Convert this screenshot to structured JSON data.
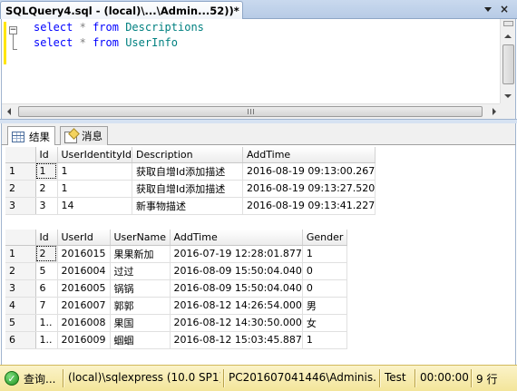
{
  "document_tab": {
    "title": "SQLQuery4.sql - (local)\\...\\Admin...52))*"
  },
  "window_buttons": {
    "pin_icon": "dropdown-arrow-icon",
    "close_label": "×"
  },
  "editor": {
    "fold_symbol": "⊟",
    "lines": [
      {
        "kw1": "select",
        "op": "*",
        "kw2": "from",
        "table": "Descriptions"
      },
      {
        "kw1": "select",
        "op": "*",
        "kw2": "from",
        "table": "UserInfo"
      }
    ]
  },
  "result_tabs": [
    {
      "label": "结果",
      "icon": "grid-icon"
    },
    {
      "label": "消息",
      "icon": "message-icon"
    }
  ],
  "grid1": {
    "columns": [
      "Id",
      "UserIdentityId",
      "Description",
      "AddTime"
    ],
    "rows": [
      {
        "row": "1",
        "cells": [
          "1",
          "1",
          "获取自增Id添加描述",
          "2016-08-19 09:13:00.267"
        ]
      },
      {
        "row": "2",
        "cells": [
          "2",
          "1",
          "获取自增Id添加描述",
          "2016-08-19 09:13:27.520"
        ]
      },
      {
        "row": "3",
        "cells": [
          "3",
          "14",
          "新事物描述",
          "2016-08-19 09:13:41.227"
        ]
      }
    ]
  },
  "grid2": {
    "columns": [
      "Id",
      "UserId",
      "UserName",
      "AddTime",
      "Gender"
    ],
    "rows": [
      {
        "row": "1",
        "cells": [
          "2",
          "2016015",
          "果果新加",
          "2016-07-19 12:28:01.877",
          "1"
        ]
      },
      {
        "row": "2",
        "cells": [
          "5",
          "2016004",
          "过过",
          "2016-08-09 15:50:04.040",
          "0"
        ]
      },
      {
        "row": "3",
        "cells": [
          "6",
          "2016005",
          "锅锅",
          "2016-08-09 15:50:04.040",
          "0"
        ]
      },
      {
        "row": "4",
        "cells": [
          "7",
          "2016007",
          "郭郭",
          "2016-08-12 14:26:54.000",
          "男"
        ]
      },
      {
        "row": "5",
        "cells": [
          "1..",
          "2016008",
          "果国",
          "2016-08-12 14:30:50.000",
          "女"
        ]
      },
      {
        "row": "6",
        "cells": [
          "1..",
          "2016009",
          "蝈蝈",
          "2016-08-12 15:03:45.887",
          "1"
        ]
      }
    ]
  },
  "status": {
    "state": "查询...",
    "server": "(local)\\sqlexpress (10.0 SP1)",
    "user": "PC201607041446\\Adminis...",
    "database": "Test",
    "elapsed": "00:00:00",
    "rows": "9 行"
  },
  "colors": {
    "keyword": "#0000ff",
    "object": "#008080",
    "operator": "#808080",
    "statusbar": "#f3e59a"
  }
}
